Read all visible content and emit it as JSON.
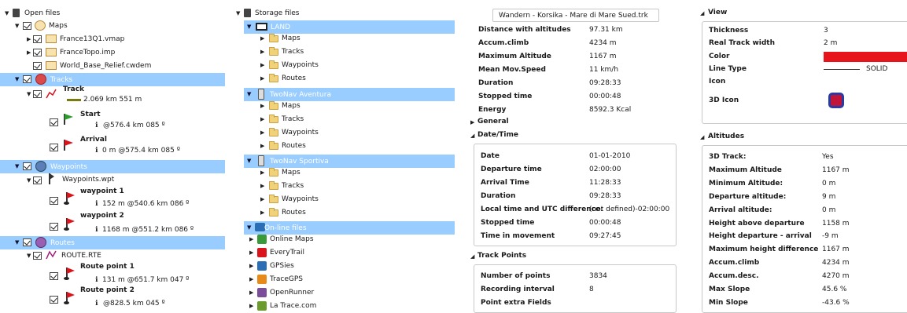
{
  "open_files": {
    "title": "Open files",
    "maps_label": "Maps",
    "maps": [
      "France13Q1.vmap",
      "FranceTopo.imp",
      "World_Base_Relief.cwdem"
    ],
    "tracks_label": "Tracks",
    "track_name": "Track",
    "track_stats": "2.069 km  551 m",
    "start_label": "Start",
    "start_stats": "@576.4 km  085 º",
    "arrival_label": "Arrival",
    "arrival_stats": "0 m  @575.4 km  085 º",
    "waypoints_label": "Waypoints",
    "waypoints_file": "Waypoints.wpt",
    "wp1_label": "waypoint 1",
    "wp1_stats": "152 m  @540.6 km  086 º",
    "wp2_label": "waypoint 2",
    "wp2_stats": "1168 m  @551.2 km  086 º",
    "routes_label": "Routes",
    "route_file": "ROUTE.RTE",
    "rp1_label": "Route point 1",
    "rp1_stats": "131 m  @651.7 km  047 º",
    "rp2_label": "Route point 2",
    "rp2_stats": "@828.5 km  045 º"
  },
  "storage_files": {
    "title": "Storage files",
    "land": "LAND",
    "aventura": "TwoNav  Aventura",
    "sportiva": "TwoNav  Sportiva",
    "sub_items": [
      "Maps",
      "Tracks",
      "Waypoints",
      "Routes"
    ],
    "online": "On-line files",
    "online_items": [
      "Online Maps",
      "EveryTrail",
      "GPSies",
      "TraceGPS",
      "OpenRunner",
      "La Trace.com"
    ]
  },
  "track_info": {
    "filename": "Wandern - Korsika - Mare di Mare Sued.trk",
    "summary": [
      {
        "k": "Distance with altitudes",
        "v": "97.31 km"
      },
      {
        "k": "Accum.climb",
        "v": "4234 m"
      },
      {
        "k": "Maximum Altitude",
        "v": "1167 m"
      },
      {
        "k": "Mean Mov.Speed",
        "v": "11 km/h"
      },
      {
        "k": "Duration",
        "v": "09:28:33"
      },
      {
        "k": "Stopped time",
        "v": "00:00:48"
      },
      {
        "k": "Energy",
        "v": "8592.3 Kcal"
      }
    ],
    "general_label": "General",
    "datetime_label": "Date/Time",
    "datetime": [
      {
        "k": "Date",
        "v": "01-01-2010"
      },
      {
        "k": "Departure time",
        "v": "02:00:00"
      },
      {
        "k": "Arrival Time",
        "v": "11:28:33"
      },
      {
        "k": "Duration",
        "v": "09:28:33"
      },
      {
        "k": "Local time and UTC difference:",
        "v": "(not defined)-02:00:00"
      },
      {
        "k": "Stopped time",
        "v": "00:00:48"
      },
      {
        "k": "Time in movement",
        "v": "09:27:45"
      }
    ],
    "trackpoints_label": "Track Points",
    "trackpoints": [
      {
        "k": "Number of points",
        "v": "3834"
      },
      {
        "k": "Recording interval",
        "v": "8"
      },
      {
        "k": "Point extra Fields",
        "v": ""
      }
    ]
  },
  "view": {
    "label": "View",
    "rows": [
      {
        "k": "Thickness",
        "v": "3"
      },
      {
        "k": "Real Track width",
        "v": "2 m"
      },
      {
        "k": "Color",
        "v": ""
      },
      {
        "k": "Line Type",
        "v": "SOLID"
      },
      {
        "k": "Icon",
        "v": ""
      },
      {
        "k": "3D Icon",
        "v": ""
      }
    ],
    "color_value": "#e8141c"
  },
  "altitudes": {
    "label": "Altitudes",
    "rows": [
      {
        "k": "3D Track:",
        "v": "Yes"
      },
      {
        "k": "Maximum Altitude",
        "v": "1167 m"
      },
      {
        "k": "Minimum Altitude:",
        "v": "0 m"
      },
      {
        "k": "Departure altitude:",
        "v": "9 m"
      },
      {
        "k": "Arrival altitude:",
        "v": "0 m"
      },
      {
        "k": "Height above departure",
        "v": "1158 m"
      },
      {
        "k": "Height departure - arrival",
        "v": "-9 m"
      },
      {
        "k": "Maximum height difference",
        "v": "1167 m"
      },
      {
        "k": "Accum.climb",
        "v": "4234 m"
      },
      {
        "k": "Accum.desc.",
        "v": "4270 m"
      },
      {
        "k": "Max Slope",
        "v": "45.6 %"
      },
      {
        "k": "Min Slope",
        "v": "-43.6 %"
      }
    ]
  },
  "colors": {
    "selection": "#99ccff",
    "flag_green": "#2e9b2e",
    "flag_red": "#d9141c"
  }
}
